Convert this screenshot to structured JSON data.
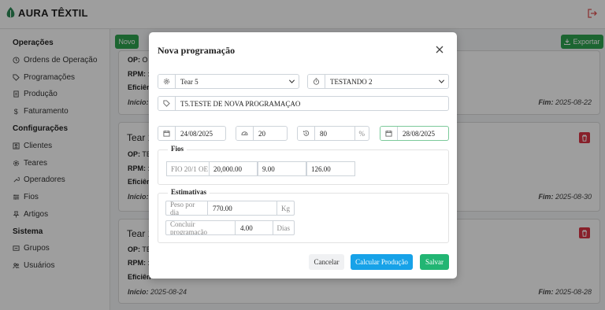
{
  "app": {
    "brand": "AURA TÊXTIL"
  },
  "sidebar": {
    "sections": [
      {
        "title": "Operações"
      },
      {
        "title": "Configurações"
      },
      {
        "title": "Sistema"
      }
    ],
    "items": [
      {
        "label": "Ordens de Operação",
        "icon": "clock-icon"
      },
      {
        "label": "Programações",
        "icon": "tag-icon"
      },
      {
        "label": "Produção",
        "icon": "document-icon"
      },
      {
        "label": "Faturamento",
        "icon": "dollar-icon"
      },
      {
        "label": "Clientes",
        "icon": "id-card-icon"
      },
      {
        "label": "Teares",
        "icon": "gear-icon"
      },
      {
        "label": "Operadores",
        "icon": "wrench-icon"
      },
      {
        "label": "Fios",
        "icon": "sliders-icon"
      },
      {
        "label": "Artigos",
        "icon": "pin-icon"
      },
      {
        "label": "Grupos",
        "icon": "group-icon"
      },
      {
        "label": "Usuários",
        "icon": "users-icon"
      }
    ]
  },
  "toolbar": {
    "novo_label": "Novo",
    "exportar_label": "Exportar"
  },
  "cards": [
    {
      "title": "",
      "op_label": "OP:",
      "op_value": "O",
      "rpm_label": "RPM:",
      "rpm_value": ":",
      "efic_label": "Eficiên",
      "inicio_label": "Início:",
      "inicio_value": "",
      "fim_label": "Fim:",
      "fim_value": "2025-08-22"
    },
    {
      "title": "Tear 1",
      "op_label": "OP:",
      "op_value": "TE",
      "rpm_label": "RPM:",
      "rpm_value": ":",
      "efic_label": "Eficiên",
      "inicio_label": "Início:",
      "inicio_value": "",
      "fim_label": "Fim:",
      "fim_value": "2025-08-30"
    },
    {
      "title": "Tear 1",
      "op_label": "OP:",
      "op_value": "TE",
      "rpm_label": "RPM:",
      "rpm_value": ":",
      "efic_label": "Eficiên",
      "inicio_label": "Início:",
      "inicio_value": "2025-08-24",
      "fim_label": "Fim:",
      "fim_value": "2025-08-28"
    }
  ],
  "modal": {
    "title": "Nova programação",
    "tear_select": "Tear 5",
    "op_select": "TESTANDO 2",
    "description": "T5.TESTE DE NOVA PROGRAMAÇAO",
    "start_date": "24/08/2025",
    "rpm": "20",
    "efficiency": "80",
    "efficiency_unit": "%",
    "end_date": "28/08/2025",
    "fios": {
      "legend": "Fios",
      "name": "FIO 20/1 OE",
      "quantity": "20,000.00",
      "value2": "9.00",
      "value3": "126.00"
    },
    "estimativas": {
      "legend": "Estimativas",
      "peso_label": "Peso por dia",
      "peso_value": "770.00",
      "peso_unit": "Kg",
      "concluir_label": "Concluir programação",
      "concluir_value": "4.00",
      "concluir_unit": "Dias"
    },
    "buttons": {
      "cancel": "Cancelar",
      "calc": "Calcular Produção",
      "save": "Salvar"
    }
  },
  "colors": {
    "primary_green": "#2ea44f",
    "danger_red": "#dc3545",
    "info_blue": "#17a2e8",
    "save_green": "#22b573"
  }
}
